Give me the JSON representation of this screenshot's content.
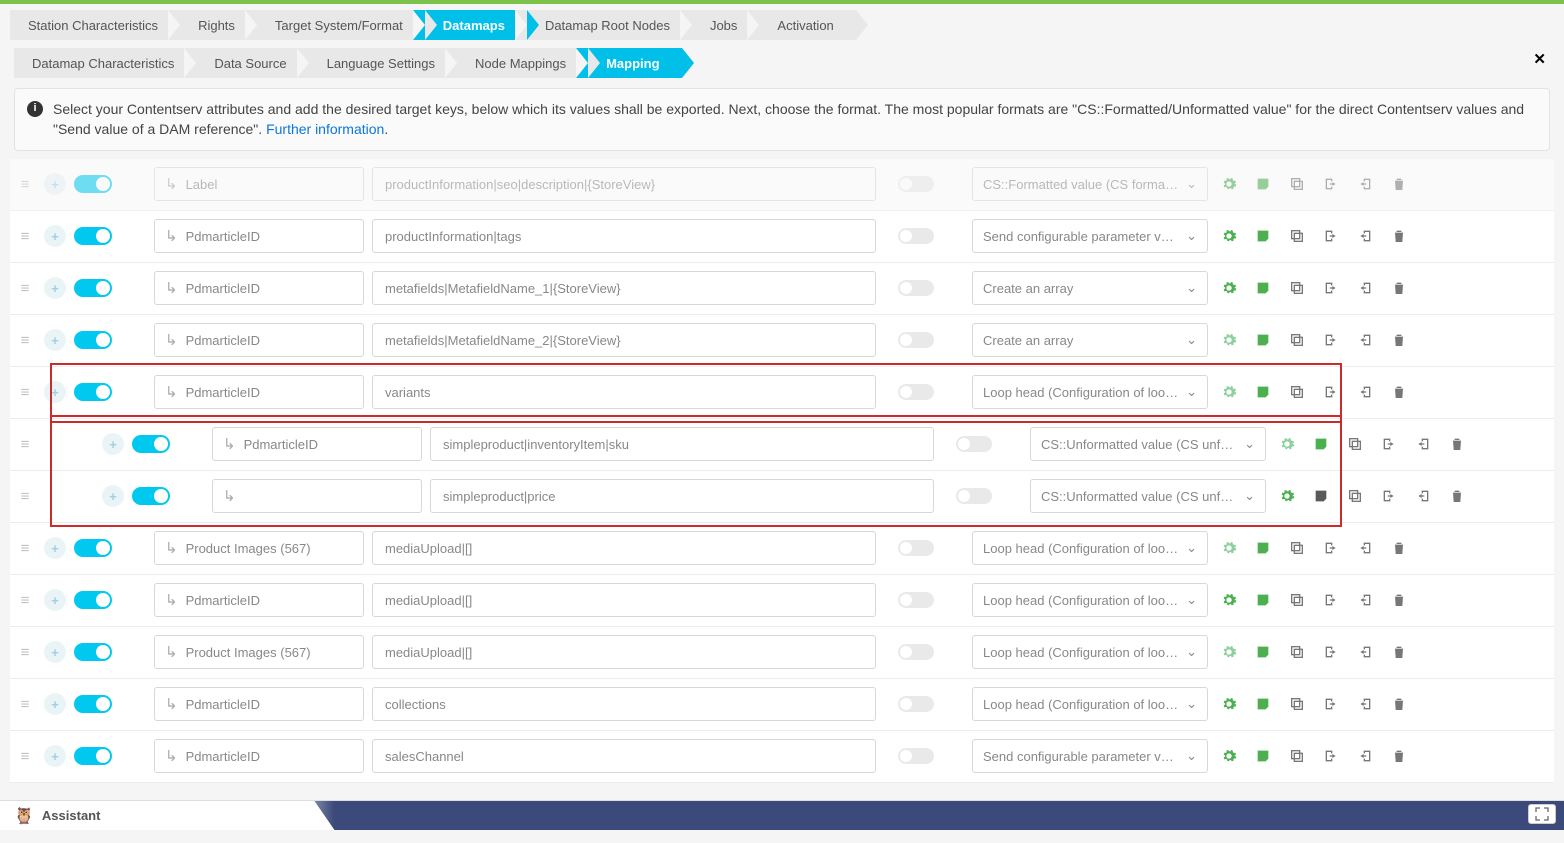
{
  "main_tabs": [
    {
      "label": "Station Characteristics",
      "active": false
    },
    {
      "label": "Rights",
      "active": false
    },
    {
      "label": "Target System/Format",
      "active": false
    },
    {
      "label": "Datamaps",
      "active": true
    },
    {
      "label": "Datamap Root Nodes",
      "active": false
    },
    {
      "label": "Jobs",
      "active": false
    },
    {
      "label": "Activation",
      "active": false
    }
  ],
  "sub_tabs": [
    {
      "label": "Datamap Characteristics",
      "active": false
    },
    {
      "label": "Data Source",
      "active": false
    },
    {
      "label": "Language Settings",
      "active": false
    },
    {
      "label": "Node Mappings",
      "active": false
    },
    {
      "label": "Mapping",
      "active": true
    }
  ],
  "info": {
    "icon": "i",
    "text_a": "Select your Contentserv attributes and add the desired target keys, below which its values shall be exported. Next, choose the format. The most popular formats are \"CS::Formatted/Unformatted value\" for the direct Contentserv values and \"Send value of a DAM reference\". ",
    "link_label": "Further information",
    "period": "."
  },
  "rows": [
    {
      "attr": "Label",
      "target": "productInformation|seo|description|{StoreView}",
      "format": "CS::Formatted value (CS formatted)",
      "nested": false,
      "hl_group": 0,
      "faded": true,
      "gear": "green"
    },
    {
      "attr": "PdmarticleID",
      "target": "productInformation|tags",
      "format": "Send configurable parameter value",
      "nested": false,
      "hl_group": 0,
      "gear": "green"
    },
    {
      "attr": "PdmarticleID",
      "target": "metafields|MetafieldName_1|{StoreView}",
      "format": "Create an array",
      "nested": false,
      "hl_group": 0,
      "gear": "green"
    },
    {
      "attr": "PdmarticleID",
      "target": "metafields|MetafieldName_2|{StoreView}",
      "format": "Create an array",
      "nested": false,
      "hl_group": 0,
      "gear": "green-light"
    },
    {
      "attr": "PdmarticleID",
      "target": "variants",
      "format": "Loop head (Configuration of loop va",
      "nested": false,
      "hl_group": 1,
      "gear": "green-light"
    },
    {
      "attr": "PdmarticleID",
      "target": "simpleproduct|inventoryItem|sku",
      "format": "CS::Unformatted value (CS unforma",
      "nested": true,
      "hl_group": 2,
      "gear": "green-light"
    },
    {
      "attr": "",
      "target": "simpleproduct|price",
      "format": "CS::Unformatted value (CS unforma",
      "nested": true,
      "hl_group": 2,
      "gear": "green",
      "note_dark": true
    },
    {
      "attr": "Product Images (567)",
      "target": "mediaUpload|[]",
      "format": "Loop head (Configuration of loop va",
      "nested": false,
      "hl_group": 0,
      "gear": "green-light"
    },
    {
      "attr": "PdmarticleID",
      "target": "mediaUpload|[]",
      "format": "Loop head (Configuration of loop va",
      "nested": false,
      "hl_group": 0,
      "gear": "green"
    },
    {
      "attr": "Product Images (567)",
      "target": "mediaUpload|[]",
      "format": "Loop head (Configuration of loop va",
      "nested": false,
      "hl_group": 0,
      "gear": "green-light"
    },
    {
      "attr": "PdmarticleID",
      "target": "collections",
      "format": "Loop head (Configuration of loop va",
      "nested": false,
      "hl_group": 0,
      "gear": "green"
    },
    {
      "attr": "PdmarticleID",
      "target": "salesChannel",
      "format": "Send configurable parameter value",
      "nested": false,
      "hl_group": 0,
      "gear": "green"
    }
  ],
  "assistant": {
    "label": "Assistant"
  }
}
